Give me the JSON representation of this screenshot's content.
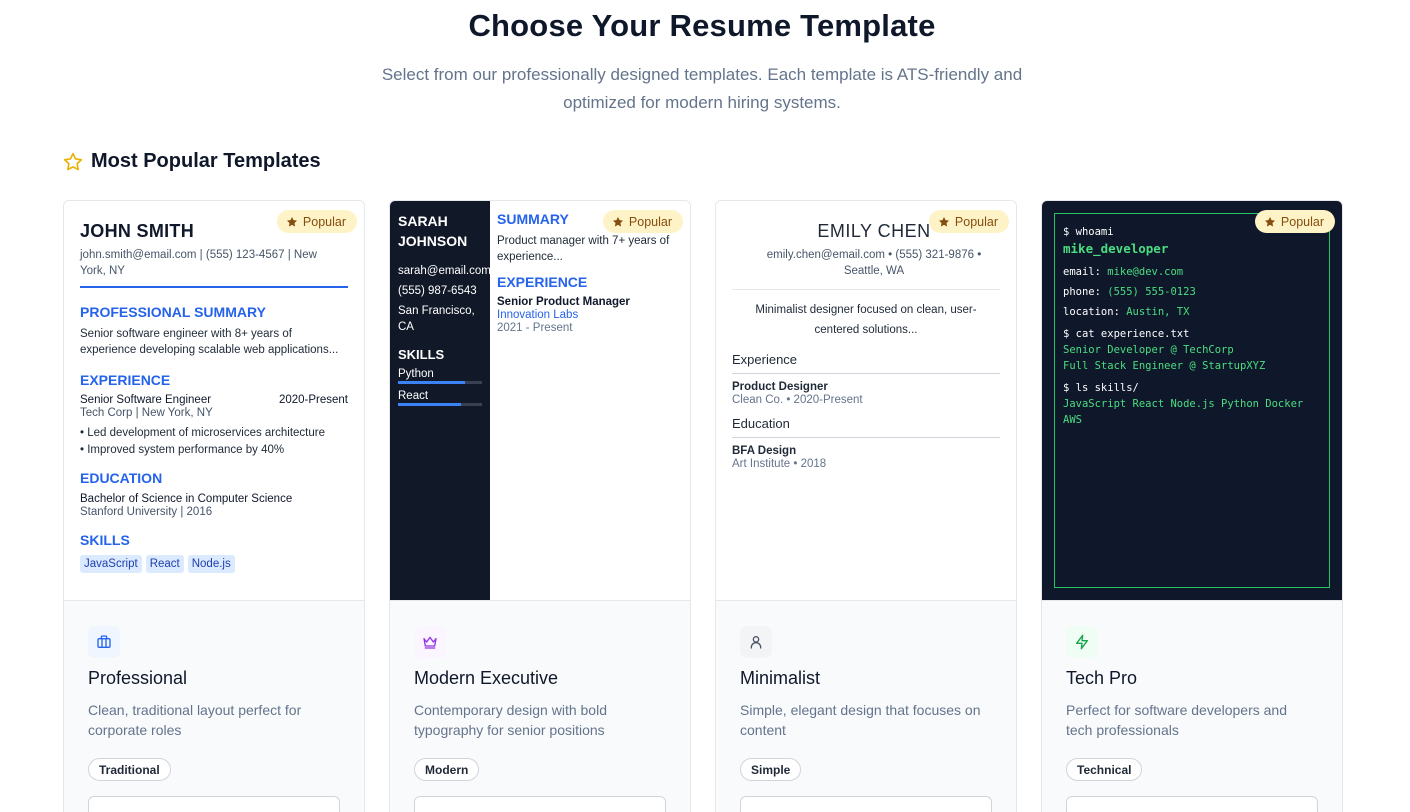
{
  "header": {
    "title": "Choose Your Resume Template",
    "subtitle_line1": "Select from our professionally designed templates. Each template is ATS-friendly and",
    "subtitle_line2": "optimized for modern hiring systems."
  },
  "section": {
    "title": "Most Popular Templates"
  },
  "badge_label": "Popular",
  "colors": {
    "accent_blue": "#2563eb",
    "popular_bg": "#fef3c7",
    "terminal_green": "#4ade80"
  },
  "templates": [
    {
      "name": "Professional",
      "description": "Clean, traditional layout perfect for corporate roles",
      "tag": "Traditional",
      "icon": "briefcase-icon",
      "preview": {
        "name": "JOHN SMITH",
        "contact": "john.smith@email.com | (555) 123-4567 | New York, NY",
        "summary_heading": "PROFESSIONAL SUMMARY",
        "summary": "Senior software engineer with 8+ years of experience developing scalable web applications...",
        "experience_heading": "EXPERIENCE",
        "role": "Senior Software Engineer",
        "role_dates": "2020-Present",
        "company": "Tech Corp | New York, NY",
        "bullet1": "• Led development of microservices architecture",
        "bullet2": "• Improved system performance by 40%",
        "education_heading": "EDUCATION",
        "degree": "Bachelor of Science in Computer Science",
        "school": "Stanford University | 2016",
        "skills_heading": "SKILLS",
        "skills": [
          "JavaScript",
          "React",
          "Node.js"
        ]
      }
    },
    {
      "name": "Modern Executive",
      "description": "Contemporary design with bold typography for senior positions",
      "tag": "Modern",
      "icon": "crown-icon",
      "preview": {
        "name_line1": "SARAH",
        "name_line2": "JOHNSON",
        "email": "sarah@email.com",
        "phone": "(555) 987-6543",
        "location_line1": "San Francisco,",
        "location_line2": "CA",
        "skills_heading": "SKILLS",
        "skill1": "Python",
        "skill1_level": 0.8,
        "skill2": "React",
        "skill2_level": 0.75,
        "summary_heading": "SUMMARY",
        "summary": "Product manager with 7+ years of experience...",
        "experience_heading": "EXPERIENCE",
        "role": "Senior Product Manager",
        "company": "Innovation Labs",
        "dates": "2021 - Present"
      }
    },
    {
      "name": "Minimalist",
      "description": "Simple, elegant design that focuses on content",
      "tag": "Simple",
      "icon": "user-icon",
      "preview": {
        "name": "EMILY CHEN",
        "contact": "emily.chen@email.com • (555) 321-9876 • Seattle, WA",
        "summary": "Minimalist designer focused on clean, user-centered solutions...",
        "experience_heading": "Experience",
        "role": "Product Designer",
        "role_detail": "Clean Co. • 2020-Present",
        "education_heading": "Education",
        "degree": "BFA Design",
        "school": "Art Institute • 2018"
      }
    },
    {
      "name": "Tech Pro",
      "description": "Perfect for software developers and tech professionals",
      "tag": "Technical",
      "icon": "zap-icon",
      "preview": {
        "cmd1": "$ whoami",
        "handle": "mike_developer",
        "email_label": "email:",
        "email": "mike@dev.com",
        "phone_label": "phone:",
        "phone": "(555) 555-0123",
        "location_label": "location:",
        "location": "Austin, TX",
        "cmd2": "$ cat experience.txt",
        "exp1": "Senior Developer @ TechCorp",
        "exp2": "Full Stack Engineer @ StartupXYZ",
        "cmd3": "$ ls skills/",
        "skills_line1": "JavaScript React Node.js Python Docker",
        "skills_line2": "AWS"
      }
    }
  ]
}
